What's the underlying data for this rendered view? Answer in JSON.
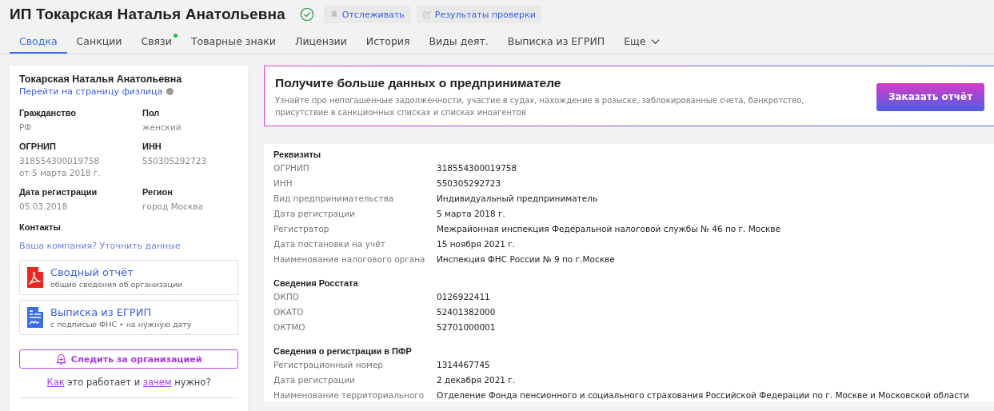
{
  "header": {
    "title": "ИП Токарская Наталья Анатольевна",
    "verified": true,
    "actions": [
      "Отслеживать",
      "Результаты проверки"
    ]
  },
  "tabs": [
    {
      "label": "Сводка",
      "selected": true,
      "dot": false
    },
    {
      "label": "Санкции",
      "selected": false,
      "dot": false
    },
    {
      "label": "Связи",
      "selected": false,
      "dot": true
    },
    {
      "label": "Товарные знаки",
      "selected": false,
      "dot": false
    },
    {
      "label": "Лицензии",
      "selected": false,
      "dot": false
    },
    {
      "label": "История",
      "selected": false,
      "dot": false
    },
    {
      "label": "Виды деят.",
      "selected": false,
      "dot": false
    },
    {
      "label": "Выписка из ЕГРИП",
      "selected": false,
      "dot": false
    }
  ],
  "more_tab": "Еще",
  "person": {
    "name": "Токарская Наталья Анатольевна",
    "link": "Перейти на страницу физлица",
    "fields": [
      {
        "label": "Гражданство",
        "values": [
          "РФ"
        ]
      },
      {
        "label": "Пол",
        "values": [
          "женский"
        ]
      },
      {
        "label": "ОГРНИП",
        "values": [
          "318554300019758",
          "от 5 марта 2018 г."
        ]
      },
      {
        "label": "ИНН",
        "values": [
          "550305292723"
        ]
      },
      {
        "label": "Дата регистрации",
        "values": [
          "05.03.2018"
        ]
      },
      {
        "label": "Регион",
        "values": [
          "город Москва"
        ]
      }
    ],
    "contacts_label": "Контакты",
    "contacts_link": "Ваша компания? Уточнить данные",
    "documents": [
      {
        "kind": "pdf",
        "title": "Сводный отчёт",
        "subtitle": "общие сведения об организации"
      },
      {
        "kind": "doc",
        "title": "Выписка из ЕГРИП",
        "subtitle": "с подписью ФНС • на нужную дату"
      }
    ],
    "follow_button": "Следить за организацией",
    "help": {
      "link1": "Как",
      "middle": " это работает и ",
      "link2": "зачем",
      "end": " нужно?"
    }
  },
  "promo": {
    "title": "Получите больше данных о предпринимателе",
    "text": "Узнайте про непогашенные задолженности, участие в судах, нахождение в розыске, заблокированные счета, банкротство, присутствие в санкционных списках и списках иноагентов",
    "button": "Заказать отчёт"
  },
  "sections": [
    {
      "title": "Реквизиты",
      "rows": [
        {
          "label": "ОГРНИП",
          "value": "318554300019758"
        },
        {
          "label": "ИНН",
          "value": "550305292723"
        },
        {
          "label": "Вид предпринимательства",
          "value": "Индивидуальный предприниматель"
        },
        {
          "label": "Дата регистрации",
          "value": "5 марта 2018 г."
        },
        {
          "label": "Регистратор",
          "value": "Межрайонная инспекция Федеральной налоговой службы № 46 по г. Москве"
        },
        {
          "label": "Дата постановки на учёт",
          "value": "15 ноября 2021 г."
        },
        {
          "label": "Наименование налогового органа",
          "value": "Инспекция ФНС России № 9 по г.Москве"
        }
      ]
    },
    {
      "title": "Сведения Росстата",
      "rows": [
        {
          "label": "ОКПО",
          "value": "0126922411"
        },
        {
          "label": "ОКАТО",
          "value": "52401382000"
        },
        {
          "label": "ОКТМО",
          "value": "52701000001"
        }
      ]
    },
    {
      "title": "Сведения о регистрации в ПФР",
      "rows": [
        {
          "label": "Регистрационный номер",
          "value": "1314467745"
        },
        {
          "label": "Дата регистрации",
          "value": "2 декабря 2021 г."
        },
        {
          "label": "Наименование территориального",
          "value": "Отделение Фонда пенсионного и социального страхования Российской Федерации по г. Москве и Московской области"
        }
      ]
    }
  ]
}
